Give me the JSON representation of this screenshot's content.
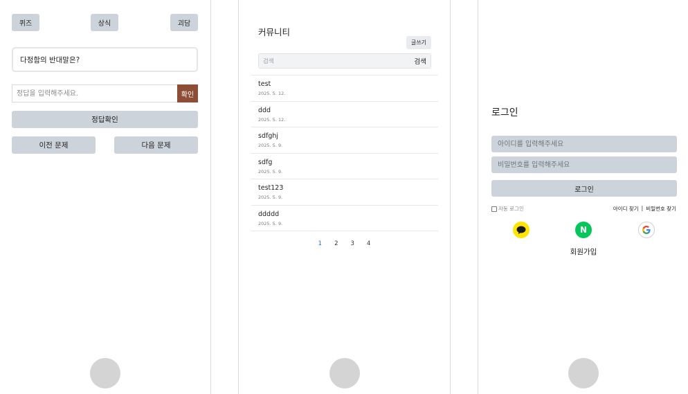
{
  "quiz_screen": {
    "categories": [
      "퀴즈",
      "상식",
      "괴담"
    ],
    "question": "다정함의 반대말은?",
    "answer_placeholder": "정답을 입력해주세요.",
    "confirm_label": "확인",
    "check_answer_label": "정답확인",
    "prev_label": "이전 문제",
    "next_label": "다음 문제",
    "colors": {
      "confirm_bg": "#8e4e35",
      "button_bg": "#cdd3da"
    }
  },
  "community_screen": {
    "title": "커뮤니티",
    "write_label": "글쓰기",
    "search_placeholder": "검색",
    "search_button": "검색",
    "posts": [
      {
        "title": "test",
        "date": "2025. 5. 12."
      },
      {
        "title": "ddd",
        "date": "2025. 5. 12."
      },
      {
        "title": "sdfghj",
        "date": "2025. 5. 9."
      },
      {
        "title": "sdfg",
        "date": "2025. 5. 9."
      },
      {
        "title": "test123",
        "date": "2025. 5. 9."
      },
      {
        "title": "ddddd",
        "date": "2025. 5. 9."
      }
    ],
    "pages": [
      "1",
      "2",
      "3",
      "4"
    ],
    "active_page": "1"
  },
  "login_screen": {
    "title": "로그인",
    "id_placeholder": "아이디를 입력해주세요",
    "pw_placeholder": "비밀번호를 입력해주세요",
    "login_button": "로그인",
    "auto_login_label": "자동 로그인",
    "find_id": "아이디 찾기",
    "separator": "|",
    "find_pw": "비밀번호 찾기",
    "social_icons": [
      "kakao-icon",
      "naver-icon",
      "google-icon"
    ],
    "naver_letter": "N",
    "signup_label": "회원가입",
    "colors": {
      "kakao": "#fee500",
      "naver": "#03c75a"
    }
  }
}
